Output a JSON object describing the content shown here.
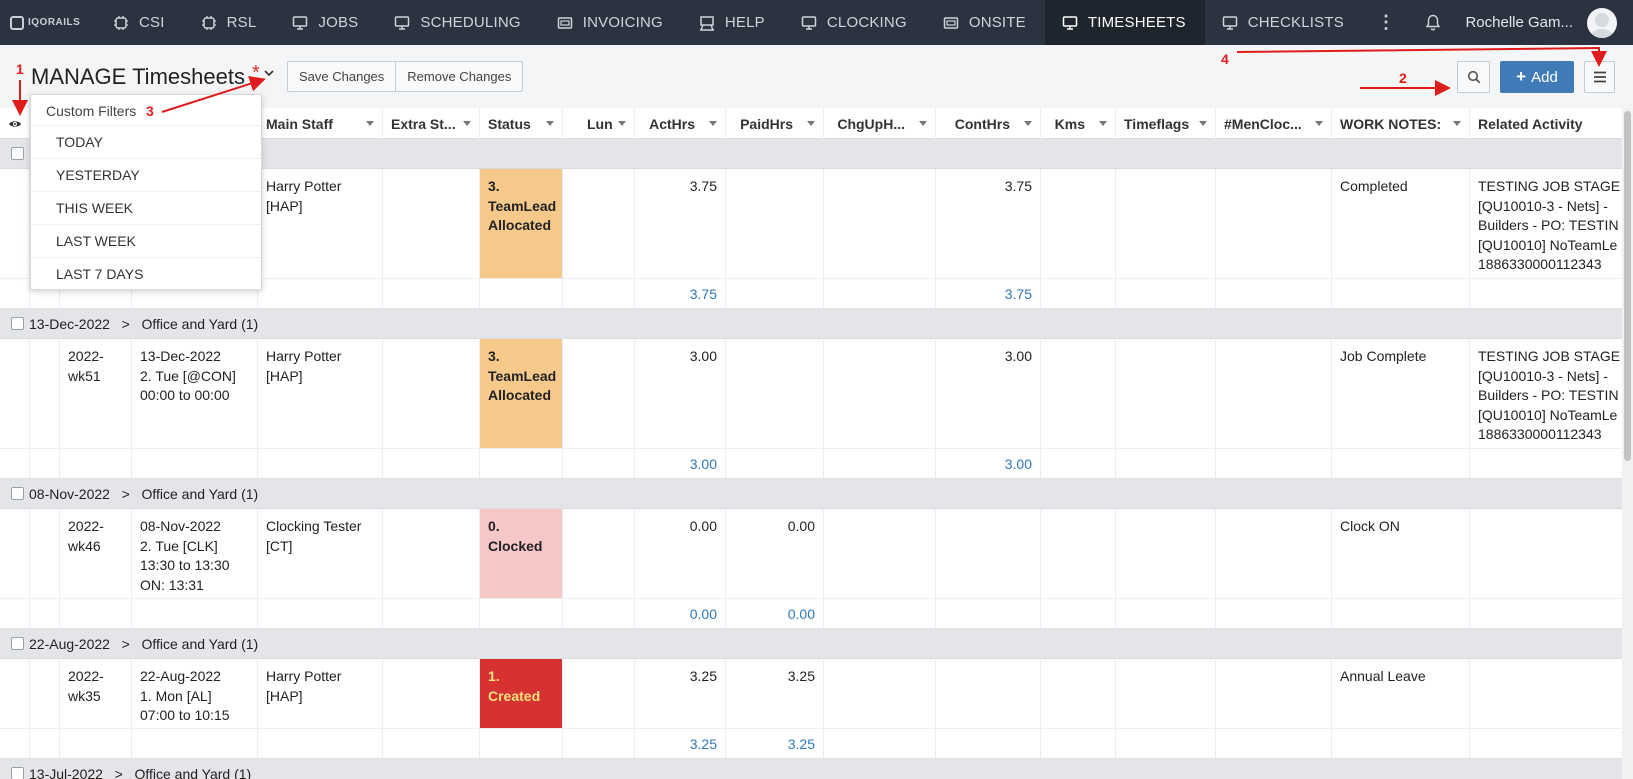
{
  "brand": {
    "text": "IQORAILS"
  },
  "nav": {
    "items": [
      {
        "label": "CSI",
        "icon": "chip-icon"
      },
      {
        "label": "RSL",
        "icon": "chip-icon"
      },
      {
        "label": "JOBS",
        "icon": "monitor-icon"
      },
      {
        "label": "SCHEDULING",
        "icon": "monitor-icon"
      },
      {
        "label": "INVOICING",
        "icon": "card-icon"
      },
      {
        "label": "HELP",
        "icon": "easel-icon"
      },
      {
        "label": "CLOCKING",
        "icon": "monitor-icon"
      },
      {
        "label": "ONSITE",
        "icon": "card-icon"
      },
      {
        "label": "TIMESHEETS",
        "icon": "monitor-icon",
        "active": true
      },
      {
        "label": "CHECKLISTS",
        "icon": "monitor-icon"
      }
    ],
    "more": "⋮",
    "user_name": "Rochelle Gam..."
  },
  "toolbar": {
    "title": "MANAGE Timesheets",
    "modified_marker": "*",
    "save_label": "Save Changes",
    "remove_label": "Remove Changes",
    "add_label": "Add"
  },
  "dropdown": {
    "heading": "Custom Filters",
    "items": [
      "TODAY",
      "YESTERDAY",
      "THIS WEEK",
      "LAST WEEK",
      "LAST 7 DAYS"
    ]
  },
  "columns": {
    "main_staff": "Main Staff",
    "extra_staff": "Extra St...",
    "status": "Status",
    "lun": "Lun",
    "act_hrs": "ActHrs",
    "paid_hrs": "PaidHrs",
    "chg_up": "ChgUpH...",
    "cont_hrs": "ContHrs",
    "kms": "Kms",
    "timeflags": "Timeflags",
    "men_clock": "#MenCloc...",
    "work_notes": "WORK NOTES:",
    "related": "Related Activity"
  },
  "rows": [
    {
      "week": "",
      "date_info": "",
      "staff": "Harry Potter\n[HAP]",
      "status": "3.\nTeamLead\nAllocated",
      "act_hrs": "3.75",
      "paid_hrs": "",
      "cont_hrs": "3.75",
      "notes": "Completed",
      "related": "TESTING JOB STAGE\n[QU10010-3 - Nets] -\nBuilders - PO: TESTIN\n[QU10010] NoTeamLe\n1886330000112343",
      "total_act": "3.75",
      "total_paid": "",
      "total_cont": "3.75"
    },
    {
      "group": "13-Dec-2022",
      "location": "Office and Yard",
      "count": "(1)",
      "week": "2022-\nwk51",
      "date_info": "13-Dec-2022\n2. Tue [@CON]\n00:00 to 00:00",
      "staff": "Harry Potter\n[HAP]",
      "status": "3.\nTeamLead\nAllocated",
      "act_hrs": "3.00",
      "paid_hrs": "",
      "cont_hrs": "3.00",
      "notes": "Job Complete",
      "related": "TESTING JOB STAGE\n[QU10010-3 - Nets] -\nBuilders - PO: TESTIN\n[QU10010] NoTeamLe\n1886330000112343",
      "total_act": "3.00",
      "total_paid": "",
      "total_cont": "3.00"
    },
    {
      "group": "08-Nov-2022",
      "location": "Office and Yard",
      "count": "(1)",
      "week": "2022-\nwk46",
      "date_info": "08-Nov-2022\n2. Tue [CLK]\n13:30 to 13:30\nON: 13:31",
      "staff": "Clocking Tester\n[CT]",
      "status": "0.\nClocked",
      "act_hrs": "0.00",
      "paid_hrs": "0.00",
      "cont_hrs": "",
      "notes": "Clock ON",
      "related": "",
      "total_act": "0.00",
      "total_paid": "0.00",
      "total_cont": ""
    },
    {
      "group": "22-Aug-2022",
      "location": "Office and Yard",
      "count": "(1)",
      "week": "2022-\nwk35",
      "date_info": "22-Aug-2022\n1. Mon [AL]\n07:00 to 10:15",
      "staff": "Harry Potter\n[HAP]",
      "status": "1.\nCreated",
      "act_hrs": "3.25",
      "paid_hrs": "3.25",
      "cont_hrs": "",
      "notes": "Annual Leave",
      "related": "",
      "total_act": "3.25",
      "total_paid": "3.25",
      "total_cont": ""
    },
    {
      "group": "13-Jul-2022",
      "location": "Office and Yard",
      "count": "(1)"
    }
  ],
  "annotations": {
    "a1": "1",
    "a2": "2",
    "a3": "3",
    "a4": "4"
  },
  "colors": {
    "nav_bg": "#2b3340",
    "accent": "#3f7bb6",
    "status_allocated": "#f6c98b",
    "status_clocked": "#f7c7c7",
    "status_created": "#d73232",
    "annotation": "#e01b1b"
  }
}
